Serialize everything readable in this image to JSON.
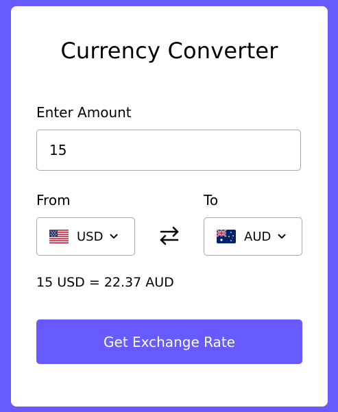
{
  "app": {
    "title": "Currency Converter"
  },
  "amount": {
    "label": "Enter Amount",
    "value": "15"
  },
  "from": {
    "label": "From",
    "currency": "USD",
    "flag_icon": "us-flag-icon"
  },
  "to": {
    "label": "To",
    "currency": "AUD",
    "flag_icon": "au-flag-icon"
  },
  "result": {
    "text": "15 USD = 22.37 AUD"
  },
  "action": {
    "button_label": "Get Exchange Rate"
  },
  "colors": {
    "accent": "#675afe",
    "card": "#ffffff",
    "border": "#a8a8a8"
  }
}
